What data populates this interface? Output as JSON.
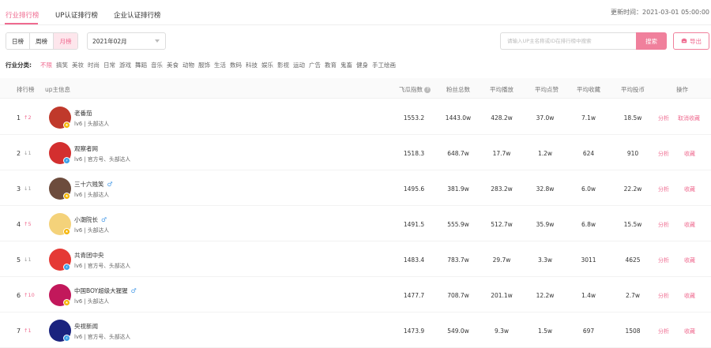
{
  "tabs": [
    {
      "label": "行业排行榜"
    },
    {
      "label": "UP认证排行榜"
    },
    {
      "label": "企业认证排行榜"
    }
  ],
  "update_time": "更新时间：2021-03-01 05:00:00",
  "period_buttons": [
    {
      "label": "日榜"
    },
    {
      "label": "周榜"
    },
    {
      "label": "月榜",
      "active": true
    }
  ],
  "month_select": {
    "value": "2021年02月"
  },
  "search": {
    "placeholder": "请输入UP主名称或ID在排行榜中搜索",
    "button": "搜索"
  },
  "export_label": "导出",
  "category_label": "行业分类:",
  "categories": [
    "不限",
    "搞笑",
    "美妆",
    "时尚",
    "日常",
    "游戏",
    "舞蹈",
    "音乐",
    "美食",
    "动物",
    "服饰",
    "生活",
    "数码",
    "科技",
    "娱乐",
    "影视",
    "运动",
    "广告",
    "教育",
    "鬼畜",
    "健身",
    "手工绘画"
  ],
  "columns": {
    "rank": "排行榜",
    "up_info": "up主信息",
    "index": "飞瓜指数",
    "fans": "粉丝总数",
    "avg_play": "平均播放",
    "avg_like": "平均点赞",
    "avg_fav": "平均收藏",
    "avg_coin": "平均投币",
    "ops": "操作"
  },
  "colors": {
    "accent": "#ef6a8f",
    "up_arrow": "#ef6a8f",
    "down_arrow": "#999999",
    "gender_male": "#4a9ce8"
  },
  "rows": [
    {
      "rank": "1",
      "change": "↑2",
      "dir": "up",
      "name": "老番茄",
      "male": false,
      "meta": "lv6 | 头部达人",
      "index": "1553.2",
      "fans": "1443.0w",
      "avg_play": "428.2w",
      "avg_like": "37.0w",
      "avg_fav": "7.1w",
      "avg_coin": "18.5w",
      "op1": "分析",
      "op2": "取消收藏",
      "avatar_color": "#c0392b",
      "badge_color": "#f5b400",
      "badge_icon": "star-icon"
    },
    {
      "rank": "2",
      "change": "↓1",
      "dir": "down",
      "name": "观察者网",
      "male": false,
      "meta": "lv6 | 官方号、头部达人",
      "index": "1518.3",
      "fans": "648.7w",
      "avg_play": "17.7w",
      "avg_like": "1.2w",
      "avg_fav": "624",
      "avg_coin": "910",
      "op1": "分析",
      "op2": "收藏",
      "avatar_color": "#d32f2f",
      "badge_color": "#3aa0e8",
      "badge_icon": "bolt-icon"
    },
    {
      "rank": "3",
      "change": "↓1",
      "dir": "down",
      "name": "三十六贱笑",
      "male": true,
      "meta": "lv6 | 头部达人",
      "index": "1495.6",
      "fans": "381.9w",
      "avg_play": "283.2w",
      "avg_like": "32.8w",
      "avg_fav": "6.0w",
      "avg_coin": "22.2w",
      "op1": "分析",
      "op2": "收藏",
      "avatar_color": "#6d4c3d",
      "badge_color": "#f5b400",
      "badge_icon": "star-icon"
    },
    {
      "rank": "4",
      "change": "↑5",
      "dir": "up",
      "name": "小潮院长",
      "male": true,
      "meta": "lv6 | 头部达人",
      "index": "1491.5",
      "fans": "555.9w",
      "avg_play": "512.7w",
      "avg_like": "35.9w",
      "avg_fav": "6.8w",
      "avg_coin": "15.5w",
      "op1": "分析",
      "op2": "收藏",
      "avatar_color": "#f4d27a",
      "badge_color": "#f5b400",
      "badge_icon": "star-icon"
    },
    {
      "rank": "5",
      "change": "↓1",
      "dir": "down",
      "name": "共青团中央",
      "male": false,
      "meta": "lv6 | 官方号、头部达人",
      "index": "1483.4",
      "fans": "783.7w",
      "avg_play": "29.7w",
      "avg_like": "3.3w",
      "avg_fav": "3011",
      "avg_coin": "4625",
      "op1": "分析",
      "op2": "收藏",
      "avatar_color": "#e53935",
      "badge_color": "#3aa0e8",
      "badge_icon": "bolt-icon"
    },
    {
      "rank": "6",
      "change": "↑10",
      "dir": "up",
      "name": "中国BOY超级大猩猩",
      "male": true,
      "meta": "lv6 | 头部达人",
      "index": "1477.7",
      "fans": "708.7w",
      "avg_play": "201.1w",
      "avg_like": "12.2w",
      "avg_fav": "1.4w",
      "avg_coin": "2.7w",
      "op1": "分析",
      "op2": "收藏",
      "avatar_color": "#c2185b",
      "badge_color": "#f5b400",
      "badge_icon": "star-icon"
    },
    {
      "rank": "7",
      "change": "↑1",
      "dir": "up",
      "name": "央视新闻",
      "male": false,
      "meta": "lv6 | 官方号、头部达人",
      "index": "1473.9",
      "fans": "549.0w",
      "avg_play": "9.3w",
      "avg_like": "1.5w",
      "avg_fav": "697",
      "avg_coin": "1508",
      "op1": "分析",
      "op2": "收藏",
      "avatar_color": "#1a237e",
      "badge_color": "#3aa0e8",
      "badge_icon": "bolt-icon"
    }
  ]
}
